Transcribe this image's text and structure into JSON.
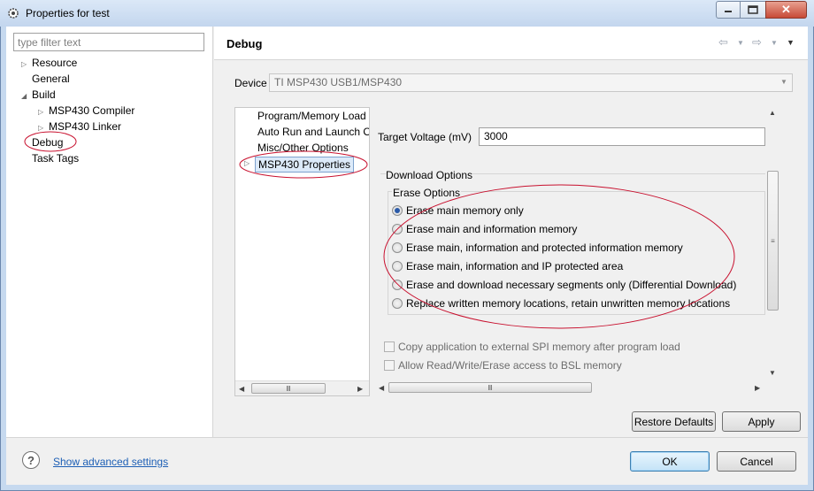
{
  "window": {
    "title": "Properties for test",
    "minimize_icon": "minimize-icon",
    "maximize_icon": "maximize-icon",
    "close_icon": "close-icon"
  },
  "filter": {
    "placeholder": "type filter text"
  },
  "tree": {
    "items": [
      {
        "label": "Resource",
        "level": 1,
        "expander": "collapsed"
      },
      {
        "label": "General",
        "level": 1,
        "expander": "none"
      },
      {
        "label": "Build",
        "level": 1,
        "expander": "expanded"
      },
      {
        "label": "MSP430 Compiler",
        "level": 2,
        "expander": "collapsed"
      },
      {
        "label": "MSP430 Linker",
        "level": 2,
        "expander": "collapsed"
      },
      {
        "label": "Debug",
        "level": 1,
        "expander": "none",
        "selected": true
      },
      {
        "label": "Task Tags",
        "level": 1,
        "expander": "none"
      }
    ]
  },
  "page": {
    "title": "Debug"
  },
  "device": {
    "label": "Device",
    "value": "TI MSP430 USB1/MSP430"
  },
  "nav": {
    "items": [
      {
        "label": "Program/Memory Load"
      },
      {
        "label": "Auto Run and Launch O"
      },
      {
        "label": "Misc/Other Options"
      },
      {
        "label": "MSP430 Properties",
        "selected": true
      }
    ]
  },
  "settings": {
    "target_voltage_label": "Target Voltage (mV)",
    "target_voltage_value": "3000",
    "download_options_label": "Download Options",
    "erase_options_label": "Erase Options",
    "erase_options": [
      {
        "label": "Erase main memory only",
        "checked": true
      },
      {
        "label": "Erase main and information memory",
        "checked": false
      },
      {
        "label": "Erase main, information and protected information memory",
        "checked": false
      },
      {
        "label": "Erase main, information and IP protected area",
        "checked": false
      },
      {
        "label": "Erase and download necessary segments only (Differential Download)",
        "checked": false
      },
      {
        "label": "Replace written memory locations, retain unwritten memory locations",
        "checked": false
      }
    ],
    "checkboxes": [
      {
        "label": "Copy application to external SPI memory after program load",
        "checked": false,
        "enabled": false
      },
      {
        "label": "Allow Read/Write/Erase access to BSL memory",
        "checked": false,
        "enabled": false
      }
    ]
  },
  "buttons": {
    "restore_defaults": "Restore Defaults",
    "apply": "Apply",
    "ok": "OK",
    "cancel": "Cancel"
  },
  "footer": {
    "advanced_link": "Show advanced settings"
  },
  "colors": {
    "annotation": "#c8102e",
    "link": "#1d5fb5",
    "selection_border": "#7da2ce"
  }
}
